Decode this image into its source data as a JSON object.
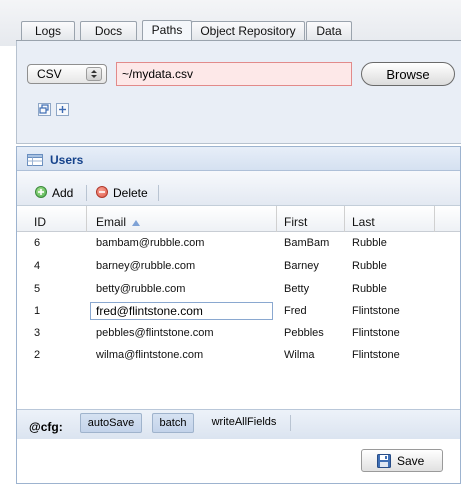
{
  "tabs": [
    {
      "label": "Logs",
      "active": false
    },
    {
      "label": "Docs",
      "active": false
    },
    {
      "label": "Paths",
      "active": true
    },
    {
      "label": "Object Repository",
      "active": false
    },
    {
      "label": "Data",
      "active": false
    }
  ],
  "paths": {
    "type_select": "CSV",
    "path_value": "~/mydata.csv",
    "browse_label": "Browse",
    "icons": [
      "restore-window-icon",
      "plus-icon"
    ]
  },
  "users": {
    "title": "Users",
    "add_label": "Add",
    "delete_label": "Delete",
    "columns": [
      "ID",
      "Email",
      "First",
      "Last"
    ],
    "sort": {
      "column": "Email",
      "direction": "ascending"
    },
    "rows": [
      {
        "id": "6",
        "email": "bambam@rubble.com",
        "first": "BamBam",
        "last": "Rubble"
      },
      {
        "id": "4",
        "email": "barney@rubble.com",
        "first": "Barney",
        "last": "Rubble"
      },
      {
        "id": "5",
        "email": "betty@rubble.com",
        "first": "Betty",
        "last": "Rubble"
      },
      {
        "id": "1",
        "email": "fred@flintstone.com",
        "first": "Fred",
        "last": "Flintstone"
      },
      {
        "id": "3",
        "email": "pebbles@flintstone.com",
        "first": "Pebbles",
        "last": "Flintstone"
      },
      {
        "id": "2",
        "email": "wilma@flintstone.com",
        "first": "Wilma",
        "last": "Flintstone"
      }
    ],
    "editing_value": "fred@flintstone.com"
  },
  "cfg": {
    "label": "@cfg:",
    "options": [
      {
        "label": "autoSave",
        "pressed": true
      },
      {
        "label": "batch",
        "pressed": true
      },
      {
        "label": "writeAllFields",
        "pressed": false
      }
    ]
  },
  "save_label": "Save",
  "colors": {
    "accent_blue": "#15428b",
    "invalid_bg": "#fde8e8",
    "add_green": "#4caf50",
    "delete_red": "#e05a4a"
  }
}
